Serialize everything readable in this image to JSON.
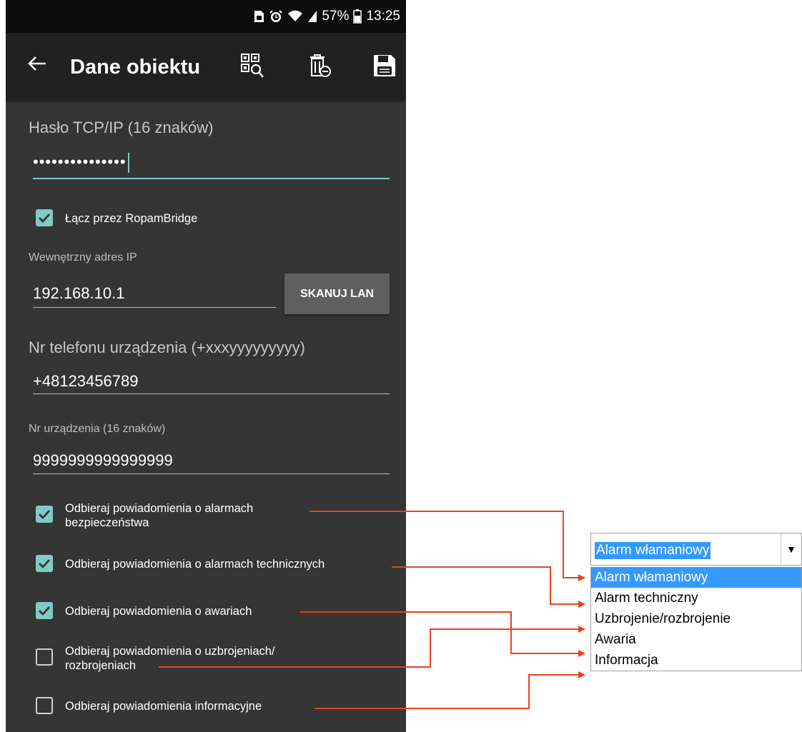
{
  "status_bar": {
    "battery": "57%",
    "time": "13:25"
  },
  "app_bar": {
    "title": "Dane obiektu",
    "back_icon": "arrow-left-icon",
    "actions": [
      "qr-scan-icon",
      "delete-icon",
      "save-icon"
    ]
  },
  "form": {
    "tcp_password": {
      "label": "Hasło TCP/IP (16 znaków)",
      "value": "•••••••••••••••"
    },
    "ropam_bridge": {
      "label": "Łącz przez RopamBridge",
      "checked": true
    },
    "internal_ip": {
      "label": "Wewnętrzny adres IP",
      "value": "192.168.10.1"
    },
    "scan_button": "SKANUJ LAN",
    "phone": {
      "label": "Nr telefonu urządzenia (+xxxyyyyyyyyy)",
      "value": "+48123456789"
    },
    "device_no": {
      "label": "Nr urządzenia (16 znaków)",
      "value": "9999999999999999"
    }
  },
  "notifications": [
    {
      "line1": "Odbieraj powiadomienia o alarmach",
      "line2": "bezpieczeństwa",
      "checked": true
    },
    {
      "line1": "Odbieraj powiadomienia o alarmach technicznych",
      "line2": "",
      "checked": true
    },
    {
      "line1": "Odbieraj powiadomienia o awariach",
      "line2": "",
      "checked": true
    },
    {
      "line1": "Odbieraj powiadomienia o uzbrojeniach/",
      "line2": "rozbrojeniach",
      "checked": false
    },
    {
      "line1": "Odbieraj powiadomienia informacyjne",
      "line2": "",
      "checked": false
    }
  ],
  "dropdown": {
    "selected": "Alarm włamaniowy",
    "options": [
      "Alarm włamaniowy",
      "Alarm techniczny",
      "Uzbrojenie/rozbrojenie",
      "Awaria",
      "Informacja"
    ]
  },
  "colors": {
    "accent": "#80cbc4",
    "connector": "#e8421c",
    "background": "#353535",
    "app_bar": "#212121"
  }
}
